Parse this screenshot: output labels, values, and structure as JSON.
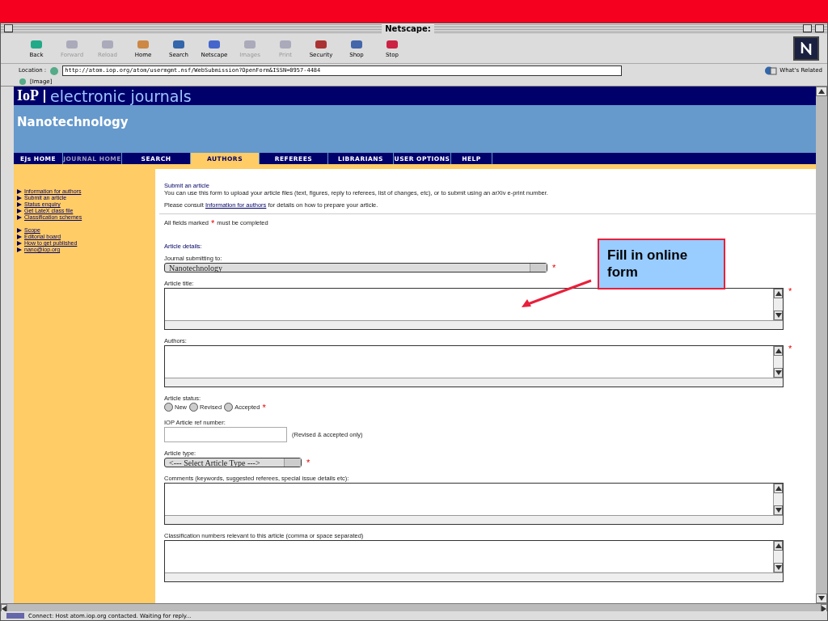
{
  "window": {
    "title": "Netscape:"
  },
  "toolbar": [
    {
      "label": "Back",
      "disabled": false
    },
    {
      "label": "Forward",
      "disabled": true
    },
    {
      "label": "Reload",
      "disabled": true
    },
    {
      "label": "Home",
      "disabled": false
    },
    {
      "label": "Search",
      "disabled": false
    },
    {
      "label": "Netscape",
      "disabled": false
    },
    {
      "label": "Images",
      "disabled": true
    },
    {
      "label": "Print",
      "disabled": true
    },
    {
      "label": "Security",
      "disabled": false
    },
    {
      "label": "Shop",
      "disabled": false
    },
    {
      "label": "Stop",
      "disabled": false
    }
  ],
  "location": {
    "label": "Location :",
    "value": "http://atom.iop.org/atom/usermgmt.nsf/WebSubmission?OpenForm&ISSN=0957-4484",
    "related": "What's Related"
  },
  "personal_bar": {
    "label": "[Image]"
  },
  "site": {
    "logo": "IoP",
    "title": "electronic journals",
    "journal": "Nanotechnology"
  },
  "nav": [
    {
      "label": "EJs HOME",
      "selected": false,
      "disabled": false
    },
    {
      "label": "JOURNAL HOME",
      "selected": false,
      "disabled": true
    },
    {
      "label": "SEARCH",
      "selected": false,
      "disabled": false
    },
    {
      "label": "AUTHORS",
      "selected": true,
      "disabled": false
    },
    {
      "label": "REFEREES",
      "selected": false,
      "disabled": false
    },
    {
      "label": "LIBRARIANS",
      "selected": false,
      "disabled": false
    },
    {
      "label": "USER OPTIONS",
      "selected": false,
      "disabled": false
    },
    {
      "label": "HELP",
      "selected": false,
      "disabled": false
    }
  ],
  "sidebar": [
    [
      {
        "label": "Information for authors",
        "selected": false
      },
      {
        "label": "Submit an article",
        "selected": true
      },
      {
        "label": "Status enquiry",
        "selected": false
      },
      {
        "label": "Get LateX class file",
        "selected": false
      },
      {
        "label": "Classification schemes",
        "selected": false
      }
    ],
    [
      {
        "label": "Scope",
        "selected": false
      },
      {
        "label": "Editorial board",
        "selected": false
      },
      {
        "label": "How to get published",
        "selected": false
      },
      {
        "label": "nano@iop.org",
        "selected": false
      }
    ]
  ],
  "intro": {
    "heading": "Submit an article",
    "text": "You can use this form to upload your article files (text, figures, reply to referees, list of changes, etc), or to submit using an arXiv e-print number.",
    "consult_before": "Please consult",
    "consult_link": "Information for authors",
    "consult_after": "for details on how to prepare your article."
  },
  "required_note": {
    "before": "All fields marked",
    "after": "must be completed",
    "mark": "*"
  },
  "section_title": "Article details:",
  "fields": [
    {
      "kind": "select",
      "label": "Journal submitting to:",
      "value": "Nanotechnology",
      "required": true
    },
    {
      "kind": "textarea",
      "label": "Article title:",
      "required": true
    },
    {
      "kind": "textarea",
      "label": "Authors:",
      "required": true
    },
    {
      "kind": "radio",
      "label": "Article status:",
      "required": true,
      "options": [
        {
          "label": "New",
          "selected": false
        },
        {
          "label": "Revised",
          "selected": false
        },
        {
          "label": "Accepted",
          "selected": false
        }
      ]
    },
    {
      "kind": "text",
      "label": "IOP Article ref number:",
      "note": "(Revised & accepted only)",
      "required": false
    },
    {
      "kind": "select",
      "label": "Article type:",
      "value": "<--- Select Article Type --->",
      "required": true
    },
    {
      "kind": "textarea",
      "label": "Comments (keywords, suggested referees, special issue details etc):",
      "required": false
    },
    {
      "kind": "textarea",
      "label": "Classification numbers relevant to this article (comma or space separated)",
      "required": false
    }
  ],
  "callout": {
    "text": "Fill in online form"
  },
  "status_bar": {
    "text": "Connect: Host atom.iop.org contacted. Waiting for reply..."
  }
}
